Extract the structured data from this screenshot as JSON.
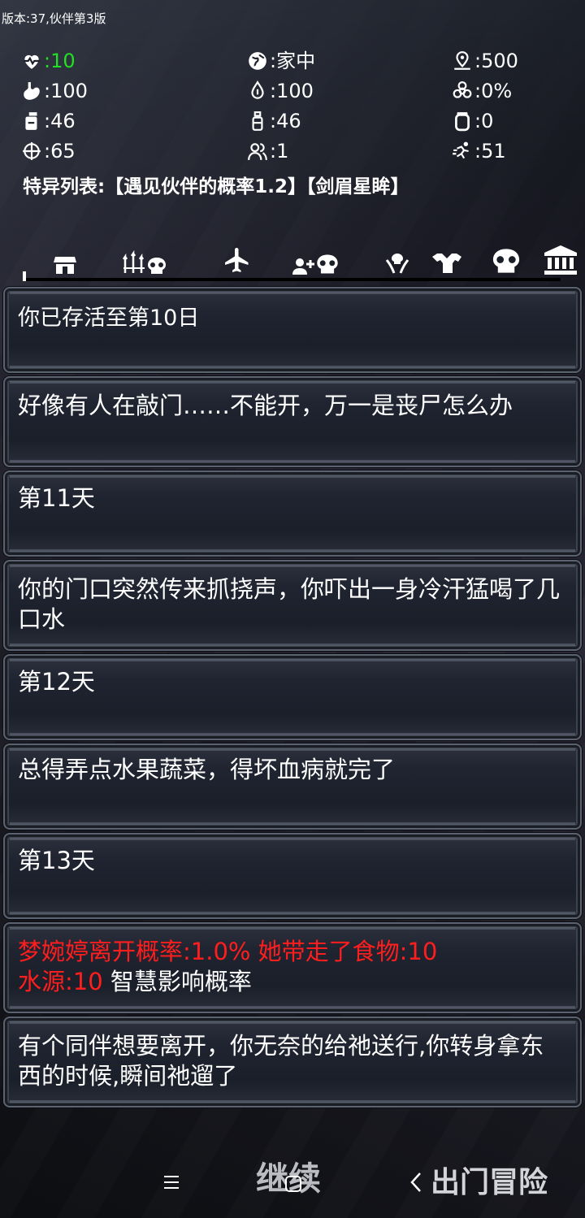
{
  "version": "版本:37,伙伴第3版",
  "stats": {
    "health": ":10",
    "location": ":家中",
    "distance": ":500",
    "food": ":100",
    "water": ":100",
    "infection": ":0%",
    "item_a": ":46",
    "item_b": ":46",
    "item_c": ":0",
    "aim": ":65",
    "companions": ":1",
    "speed": ":51"
  },
  "traits": "特异列表:【遇见伙伴的概率1.2】【剑眉星眸】",
  "nav_icons": [
    "shop-icon",
    "trident-skull-icon",
    "airplane-icon",
    "add-companion-skull-icon",
    "hands-skull-icon",
    "muscle-icon",
    "skull-icon",
    "bank-icon"
  ],
  "log": [
    {
      "text": "你已存活至第10日",
      "style": "yellow"
    },
    {
      "text": "好像有人在敲门……不能开，万一是丧尸怎么办",
      "style": "white"
    },
    {
      "text": "第11天",
      "style": "white"
    },
    {
      "text": "你的门口突然传来抓挠声，你吓出一身冷汗猛喝了几口水",
      "style": "white"
    },
    {
      "text": "第12天",
      "style": "white"
    },
    {
      "text": "总得弄点水果蔬菜，得坏血病就完了",
      "style": "white"
    },
    {
      "text": "第13天",
      "style": "white"
    }
  ],
  "leave_event": {
    "line1_red": " 梦婉婷离开概率:1.0%  她带走了食物:10",
    "line2_red": "水源:10",
    "line2_white": "  智慧影响概率"
  },
  "last_log": "有个同伴想要离开，你无奈的给祂送行,你转身拿东西的时候,瞬间祂遛了",
  "buttons": {
    "continue": "继续",
    "go_out": "出门冒险"
  },
  "colors": {
    "yellow": "#ffe400",
    "red": "#ff1e1e",
    "green": "#22e022"
  }
}
